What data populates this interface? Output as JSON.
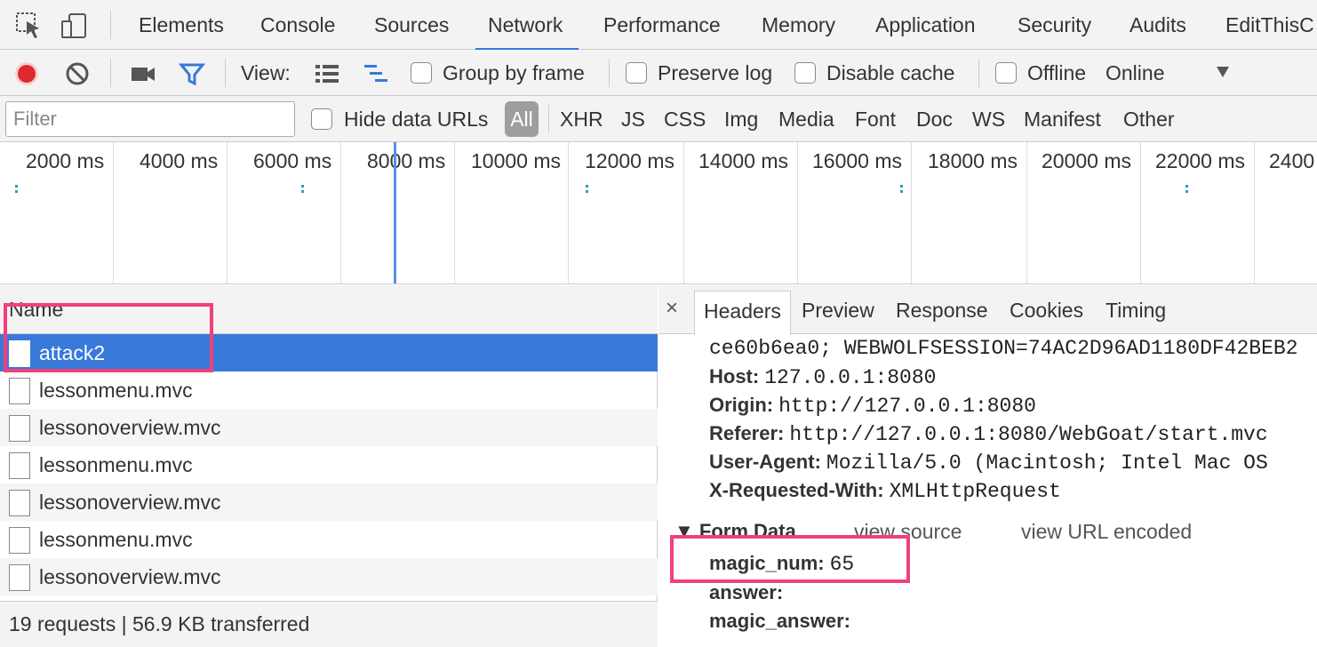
{
  "tabs": {
    "elements": "Elements",
    "console": "Console",
    "sources": "Sources",
    "network": "Network",
    "performance": "Performance",
    "memory": "Memory",
    "application": "Application",
    "security": "Security",
    "audits": "Audits",
    "editthiscookie": "EditThisC"
  },
  "toolbar": {
    "view_label": "View:",
    "group_by_frame": "Group by frame",
    "preserve_log": "Preserve log",
    "disable_cache": "Disable cache",
    "offline": "Offline",
    "throttle": "Online",
    "record_color": "#e0282e",
    "filter_color": "#3879d9"
  },
  "filter": {
    "placeholder": "Filter",
    "hide_data_urls": "Hide data URLs",
    "types": [
      "All",
      "XHR",
      "JS",
      "CSS",
      "Img",
      "Media",
      "Font",
      "Doc",
      "WS",
      "Manifest",
      "Other"
    ]
  },
  "timeline": {
    "labels": [
      "2000 ms",
      "4000 ms",
      "6000 ms",
      "8000 ms",
      "10000 ms",
      "12000 ms",
      "14000 ms",
      "16000 ms",
      "18000 ms",
      "20000 ms",
      "22000 ms",
      "2400"
    ]
  },
  "list": {
    "header": "Name",
    "rows": [
      "attack2",
      "lessonmenu.mvc",
      "lessonoverview.mvc",
      "lessonmenu.mvc",
      "lessonoverview.mvc",
      "lessonmenu.mvc",
      "lessonoverview.mvc"
    ],
    "selected_color": "#3879d9",
    "status": "19 requests | 56.9 KB transferred"
  },
  "details": {
    "close": "×",
    "tabs": [
      "Headers",
      "Preview",
      "Response",
      "Cookies",
      "Timing"
    ],
    "cookie_line": "ce60b6ea0; WEBWOLFSESSION=74AC2D96AD1180DF42BEB2",
    "headers": [
      {
        "key": "Host:",
        "value": "127.0.0.1:8080"
      },
      {
        "key": "Origin:",
        "value": "http://127.0.0.1:8080"
      },
      {
        "key": "Referer:",
        "value": "http://127.0.0.1:8080/WebGoat/start.mvc"
      },
      {
        "key": "User-Agent:",
        "value": "Mozilla/5.0 (Macintosh; Intel Mac OS"
      },
      {
        "key": "X-Requested-With:",
        "value": "XMLHttpRequest"
      }
    ],
    "form_data_title": "▼ Form Data",
    "view_source": "view source",
    "view_url_encoded": "view URL encoded",
    "form_data": [
      {
        "key": "magic_num:",
        "value": "65"
      },
      {
        "key": "answer:",
        "value": ""
      },
      {
        "key": "magic_answer:",
        "value": ""
      }
    ]
  },
  "annotation_color": "#f0407a"
}
